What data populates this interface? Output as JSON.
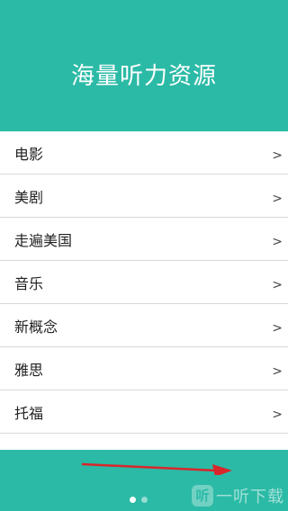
{
  "header": {
    "title": "海量听力资源"
  },
  "list": {
    "items": [
      {
        "label": "电影",
        "chevron": ">"
      },
      {
        "label": "美剧",
        "chevron": ">"
      },
      {
        "label": "走遍美国",
        "chevron": ">"
      },
      {
        "label": "音乐",
        "chevron": ">"
      },
      {
        "label": "新概念",
        "chevron": ">"
      },
      {
        "label": "雅思",
        "chevron": ">"
      },
      {
        "label": "托福",
        "chevron": ">"
      }
    ]
  },
  "pager": {
    "current_page": 1,
    "total_pages": 2
  },
  "watermark": {
    "icon_char": "听",
    "text": "一听下载"
  },
  "colors": {
    "accent": "#2bbaa6",
    "arrow": "#d9262b"
  }
}
